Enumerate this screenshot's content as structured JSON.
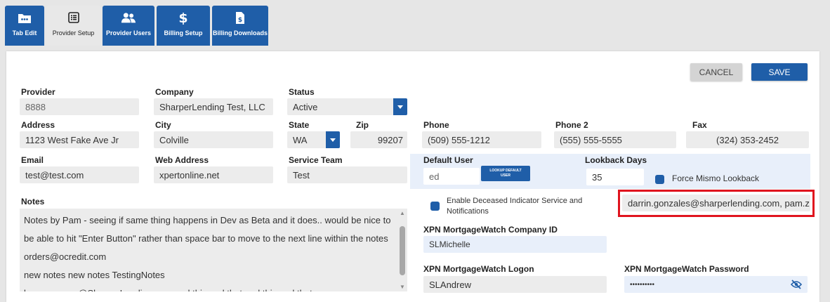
{
  "tabs": [
    {
      "label": "Tab Edit",
      "icon": "ellipsis-folder-icon",
      "active": false
    },
    {
      "label": "Provider Setup",
      "icon": "list-icon",
      "active": true
    },
    {
      "label": "Provider Users",
      "icon": "users-icon",
      "active": false
    },
    {
      "label": "Billing Setup",
      "icon": "dollar-icon",
      "active": false
    },
    {
      "label": "Billing Downloads",
      "icon": "file-dollar-icon",
      "active": false
    }
  ],
  "actions": {
    "cancel": "CANCEL",
    "save": "SAVE"
  },
  "form": {
    "provider": {
      "label": "Provider",
      "value": "8888"
    },
    "company": {
      "label": "Company",
      "value": "SharperLending Test, LLC"
    },
    "status": {
      "label": "Status",
      "value": "Active"
    },
    "address": {
      "label": "Address",
      "value": "1123 West Fake Ave Jr"
    },
    "city": {
      "label": "City",
      "value": "Colville"
    },
    "state": {
      "label": "State",
      "value": "WA"
    },
    "zip": {
      "label": "Zip",
      "value": "99207"
    },
    "phone": {
      "label": "Phone",
      "value": "(509) 555-1212"
    },
    "phone2": {
      "label": "Phone 2",
      "value": "(555) 555-5555"
    },
    "fax": {
      "label": "Fax",
      "value": "(324) 353-2452"
    },
    "email": {
      "label": "Email",
      "value": "test@test.com"
    },
    "web_address": {
      "label": "Web Address",
      "value": "xpertonline.net"
    },
    "service_team": {
      "label": "Service Team",
      "value": "Test"
    },
    "default_user": {
      "label": "Default User",
      "value": "ed",
      "lookup_line1": "LOOKUP DEFAULT",
      "lookup_line2": "USER"
    },
    "lookback_days": {
      "label": "Lookback Days",
      "value": "35"
    },
    "force_mismo": {
      "label": "Force Mismo Lookback"
    },
    "notes": {
      "label": "Notes",
      "lines": [
        "Notes by Pam - seeing if same thing happens in Dev as Beta and it does.. would be nice to",
        "be able to hit \"Enter Button\" rather than space bar to move to the next line within the notes",
        "orders@ocredit.com",
        "new notes new notes TestingNotes",
        "bryan.sawyer@SharperLending.com and this and that and this and that."
      ]
    },
    "deceased": {
      "line1": "Enable Deceased Indicator Service and",
      "line2": "Notifications"
    },
    "notification_emails": {
      "value": "darrin.gonzales@sharperlending.com, pam.z"
    },
    "xpn_company_id": {
      "label": "XPN MortgageWatch Company ID",
      "value": "SLMichelle"
    },
    "xpn_logon": {
      "label": "XPN MortgageWatch Logon",
      "value": "SLAndrew"
    },
    "xpn_password": {
      "label": "XPN MortgageWatch Password",
      "value": "••••••••••"
    }
  },
  "colors": {
    "primary": "#1f5ea8",
    "highlight": "#e0141e"
  }
}
